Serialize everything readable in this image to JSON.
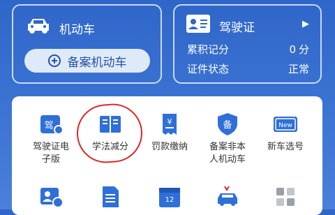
{
  "vehicle_card": {
    "title": "机动车",
    "icon": "car-icon",
    "register_button": "备案机动车"
  },
  "license_card": {
    "title": "驾驶证",
    "icon": "id-card-icon",
    "points_label": "累积记分",
    "points_value": "0",
    "points_unit": "分",
    "status_label": "证件状态",
    "status_value": "正常"
  },
  "services": [
    {
      "label_line1": "驾驶证电",
      "label_line2": "子版",
      "icon": "e-license-icon",
      "icon_text": "驾"
    },
    {
      "label_line1": "学法减分",
      "label_line2": "",
      "icon": "book-icon"
    },
    {
      "label_line1": "罚款缴纳",
      "label_line2": "",
      "icon": "fine-receipt-icon",
      "icon_text": "¥"
    },
    {
      "label_line1": "备案非本",
      "label_line2": "人机动车",
      "icon": "shield-icon",
      "icon_text": "备"
    },
    {
      "label_line1": "新车选号",
      "label_line2": "",
      "icon": "new-plate-icon",
      "icon_text": "New"
    },
    {
      "label_line1": "",
      "label_line2": "",
      "icon": "id-switch-icon"
    },
    {
      "label_line1": "",
      "label_line2": "",
      "icon": "document-icon"
    },
    {
      "label_line1": "",
      "label_line2": "",
      "icon": "calendar-icon",
      "icon_text": "12"
    },
    {
      "label_line1": "",
      "label_line2": "",
      "icon": "car-accident-icon"
    },
    {
      "label_line1": "",
      "label_line2": "",
      "icon": "more-apps-icon"
    }
  ],
  "colors": {
    "header_blue": "#2f66c9",
    "accent_blue": "#2f6fd8",
    "annotation_red": "#d9282a"
  }
}
